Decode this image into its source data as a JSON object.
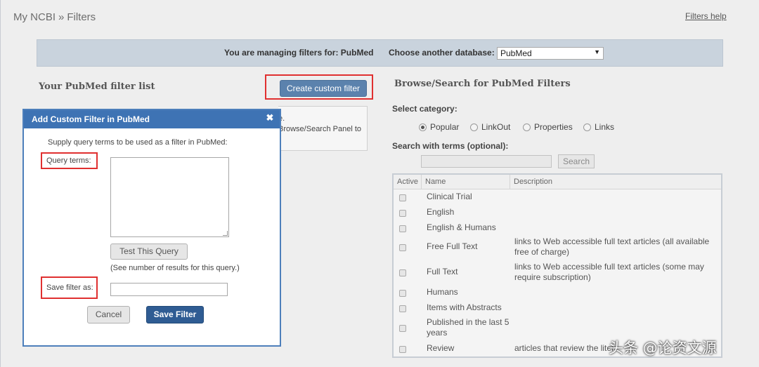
{
  "breadcrumb": {
    "root": "My NCBI",
    "separator": "»",
    "current": "Filters"
  },
  "help_link": "Filters help",
  "db_bar": {
    "managing_text": "You are managing filters for: PubMed",
    "choose_label": "Choose another database:",
    "selected_db": "PubMed"
  },
  "left": {
    "title": "Your PubMed filter list",
    "create_button": "Create custom filter",
    "panel_clip_1": "e.",
    "panel_clip_2": "Browse/Search Panel to"
  },
  "browse": {
    "title": "Browse/Search for PubMed Filters",
    "category_label": "Select category:",
    "categories": [
      "Popular",
      "LinkOut",
      "Properties",
      "Links"
    ],
    "selected_category": "Popular",
    "terms_label": "Search with terms (optional):",
    "search_button": "Search"
  },
  "table": {
    "headers": [
      "Active",
      "Name",
      "Description"
    ],
    "rows": [
      {
        "name": "Clinical Trial",
        "description": ""
      },
      {
        "name": "English",
        "description": ""
      },
      {
        "name": "English & Humans",
        "description": ""
      },
      {
        "name": "Free Full Text",
        "description": "links to Web accessible full text articles (all available free of charge)"
      },
      {
        "name": "Full Text",
        "description": "links to Web accessible full text articles (some may require subscription)"
      },
      {
        "name": "Humans",
        "description": ""
      },
      {
        "name": "Items with Abstracts",
        "description": ""
      },
      {
        "name": "Published in the last 5 years",
        "description": ""
      },
      {
        "name": "Review",
        "description": "articles that review the liter"
      }
    ]
  },
  "dialog": {
    "title": "Add Custom Filter in PubMed",
    "close_glyph": "✖",
    "instruction": "Supply query terms to be used as a filter in PubMed:",
    "query_label": "Query terms:",
    "test_button": "Test This Query",
    "results_note": "(See number of results for this query.)",
    "save_label": "Save filter as:",
    "cancel_button": "Cancel",
    "save_button": "Save Filter"
  },
  "watermark": "头条 @论资文源",
  "colors": {
    "dialog_header": "#3e73b4",
    "primary_button": "#2f5c93",
    "highlight": "#e03030"
  }
}
